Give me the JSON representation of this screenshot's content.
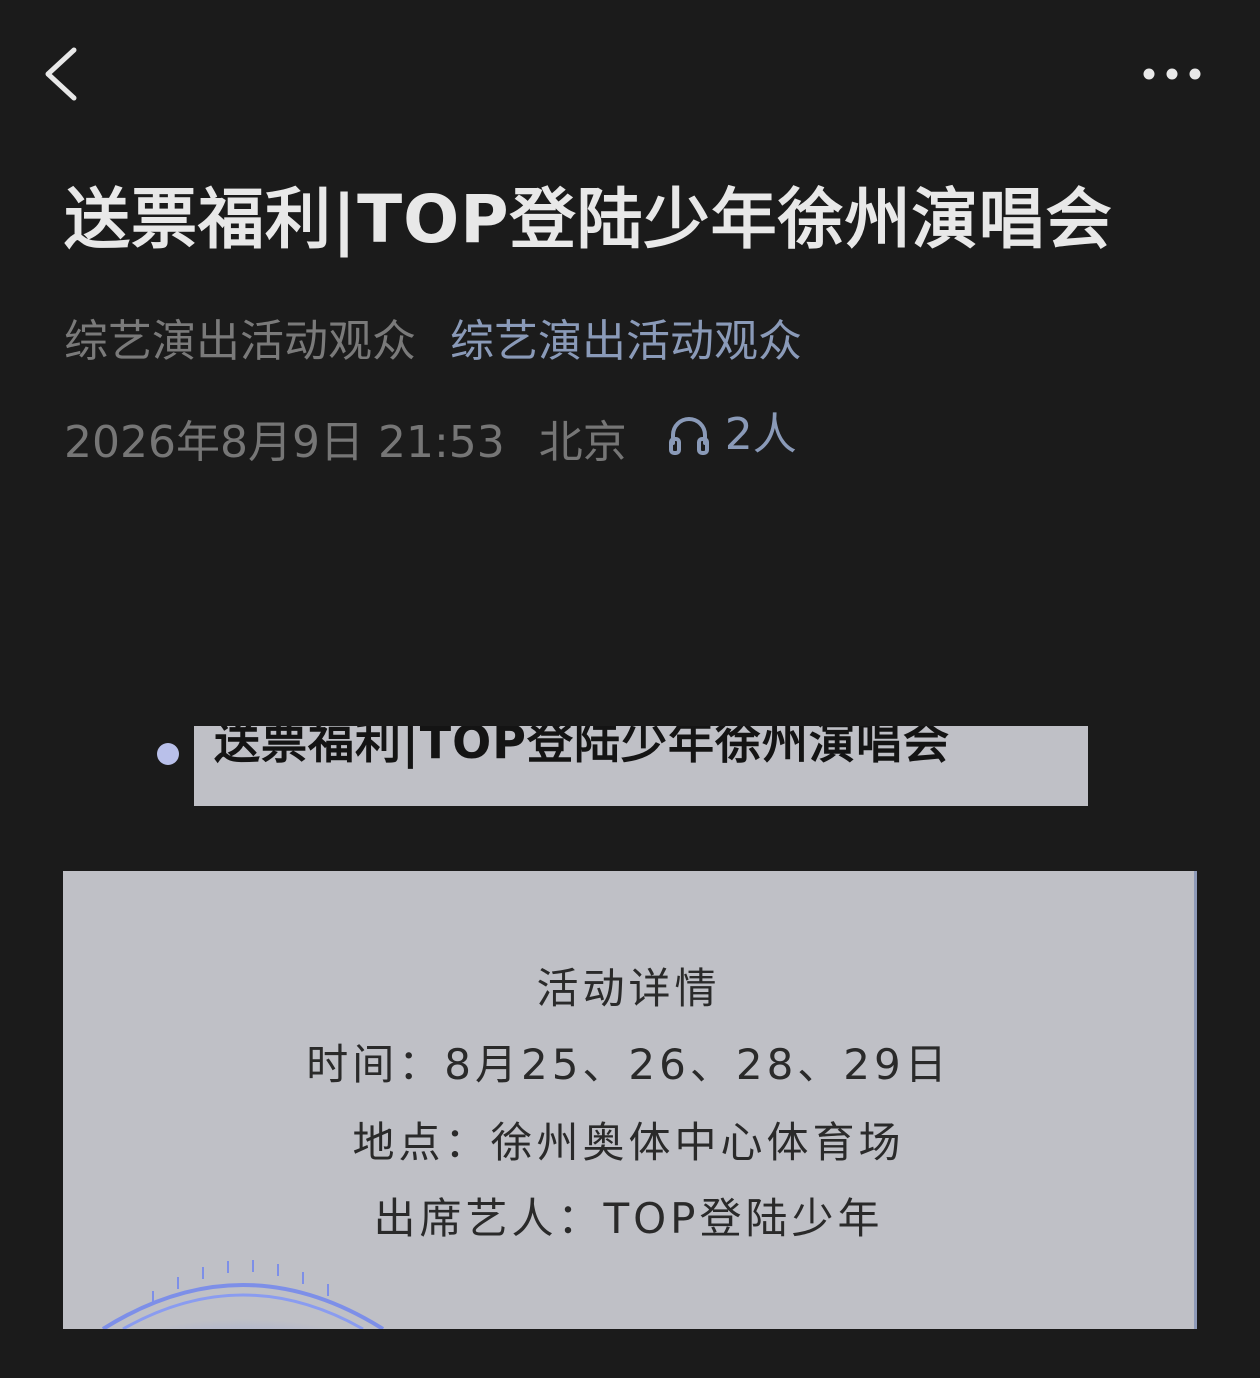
{
  "header": {
    "back_icon": "chevron-left-icon",
    "more_icon": "more-horizontal-icon"
  },
  "post": {
    "title": "送票福利|TOP登陆少年徐州演唱会",
    "author": "综艺演出活动观众",
    "channel": "综艺演出活动观众",
    "date": "2026年8月9日 21:53",
    "location": "北京",
    "listeners_icon": "headphones-icon",
    "listeners": "2人"
  },
  "content": {
    "heading": "送票福利|TOP登陆少年徐州演唱会",
    "detail": {
      "title": "活动详情",
      "time": "时间：8月25、26、28、29日",
      "place": "地点：徐州奥体中心体育场",
      "artist": "出席艺人：TOP登陆少年"
    }
  },
  "colors": {
    "background": "#1b1b1b",
    "accent": "#8a9ab8",
    "card": "#bfc0c6",
    "bullet": "#b9c0ea"
  }
}
